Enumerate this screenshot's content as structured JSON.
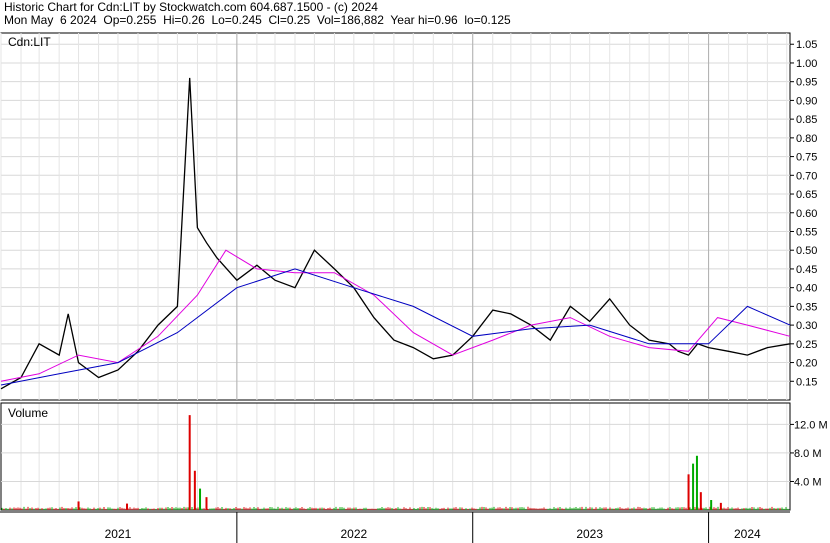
{
  "header": {
    "line1": "Historic Chart for Cdn:LIT by Stockwatch.com 604.687.1500 - (c) 2024",
    "line2": "Mon May  6 2024  Op=0.255  Hi=0.26  Lo=0.245  Cl=0.25  Vol=186,882  Year hi=0.96  lo=0.125"
  },
  "chart_data": [
    {
      "type": "line",
      "symbol_label": "Cdn:LIT",
      "ylim": [
        0.1,
        1.08
      ],
      "y_ticks": [
        0.15,
        0.2,
        0.25,
        0.3,
        0.35,
        0.4,
        0.45,
        0.5,
        0.55,
        0.6,
        0.65,
        0.7,
        0.75,
        0.8,
        0.85,
        0.9,
        0.95,
        1.0,
        1.05
      ],
      "y_tick_labels": [
        "0.15",
        "0.20",
        "0.25",
        "0.30",
        "0.35",
        "0.40",
        "0.45",
        "0.50",
        "0.55",
        "0.60",
        "0.65",
        "0.70",
        "0.75",
        "0.80",
        "0.85",
        "0.90",
        "0.95",
        "1.00",
        "1.05"
      ],
      "x_range": [
        "2021-01-01",
        "2024-05-06"
      ],
      "x_labels": [
        {
          "date": "2021-07-01",
          "label": "2021"
        },
        {
          "date": "2022-07-01",
          "label": "2022"
        },
        {
          "date": "2023-07-01",
          "label": "2023"
        },
        {
          "date": "2024-03-01",
          "label": "2024"
        }
      ],
      "year_dividers": [
        "2022-01-01",
        "2023-01-01",
        "2024-01-01"
      ],
      "series": [
        {
          "color": "#000000",
          "x": [
            "2021-01-01",
            "2021-02-01",
            "2021-03-01",
            "2021-04-01",
            "2021-04-15",
            "2021-05-01",
            "2021-06-01",
            "2021-07-01",
            "2021-08-01",
            "2021-09-01",
            "2021-10-01",
            "2021-10-20",
            "2021-11-01",
            "2021-11-15",
            "2021-12-01",
            "2022-01-01",
            "2022-02-01",
            "2022-03-01",
            "2022-04-01",
            "2022-05-01",
            "2022-06-01",
            "2022-07-01",
            "2022-08-01",
            "2022-09-01",
            "2022-10-01",
            "2022-11-01",
            "2022-12-01",
            "2023-01-01",
            "2023-02-01",
            "2023-03-01",
            "2023-04-01",
            "2023-05-01",
            "2023-06-01",
            "2023-07-01",
            "2023-08-01",
            "2023-09-01",
            "2023-10-01",
            "2023-11-01",
            "2023-11-15",
            "2023-12-01",
            "2023-12-15",
            "2024-01-01",
            "2024-02-01",
            "2024-03-01",
            "2024-04-01",
            "2024-05-06"
          ],
          "y": [
            0.13,
            0.16,
            0.25,
            0.22,
            0.33,
            0.2,
            0.16,
            0.18,
            0.23,
            0.3,
            0.35,
            0.96,
            0.56,
            0.52,
            0.48,
            0.42,
            0.46,
            0.42,
            0.4,
            0.5,
            0.45,
            0.4,
            0.32,
            0.26,
            0.24,
            0.21,
            0.22,
            0.27,
            0.34,
            0.33,
            0.3,
            0.26,
            0.35,
            0.31,
            0.37,
            0.3,
            0.26,
            0.25,
            0.23,
            0.22,
            0.25,
            0.24,
            0.23,
            0.22,
            0.24,
            0.25
          ]
        },
        {
          "color": "#e000e0",
          "x": [
            "2021-01-01",
            "2021-03-01",
            "2021-05-01",
            "2021-07-01",
            "2021-09-01",
            "2021-11-01",
            "2021-12-15",
            "2022-02-01",
            "2022-04-01",
            "2022-06-01",
            "2022-08-01",
            "2022-10-01",
            "2022-12-01",
            "2023-02-01",
            "2023-04-01",
            "2023-06-01",
            "2023-08-01",
            "2023-10-01",
            "2023-12-01",
            "2024-01-15",
            "2024-03-01",
            "2024-05-06"
          ],
          "y": [
            0.15,
            0.17,
            0.22,
            0.2,
            0.27,
            0.38,
            0.5,
            0.45,
            0.44,
            0.44,
            0.38,
            0.28,
            0.22,
            0.26,
            0.3,
            0.32,
            0.27,
            0.24,
            0.23,
            0.32,
            0.3,
            0.27
          ]
        },
        {
          "color": "#0000c0",
          "x": [
            "2021-01-01",
            "2021-04-01",
            "2021-07-01",
            "2021-10-01",
            "2022-01-01",
            "2022-04-01",
            "2022-07-01",
            "2022-10-01",
            "2023-01-01",
            "2023-04-01",
            "2023-07-01",
            "2023-10-01",
            "2024-01-01",
            "2024-03-01",
            "2024-05-06"
          ],
          "y": [
            0.14,
            0.17,
            0.2,
            0.28,
            0.4,
            0.45,
            0.4,
            0.35,
            0.27,
            0.29,
            0.3,
            0.25,
            0.25,
            0.35,
            0.3
          ]
        }
      ]
    },
    {
      "type": "bar",
      "title": "Volume",
      "ylim": [
        0,
        15
      ],
      "y_ticks": [
        4,
        8,
        12
      ],
      "y_tick_labels": [
        "4.0 M",
        "8.0 M",
        "12.0 M"
      ],
      "x_range": [
        "2021-01-01",
        "2024-05-06"
      ],
      "colors": {
        "up": "#00aa00",
        "down": "#dd0000"
      },
      "spikes": [
        {
          "date": "2021-05-01",
          "value": 1.2,
          "color": "down"
        },
        {
          "date": "2021-07-15",
          "value": 0.9,
          "color": "down"
        },
        {
          "date": "2021-10-20",
          "value": 13.3,
          "color": "down"
        },
        {
          "date": "2021-10-28",
          "value": 5.5,
          "color": "down"
        },
        {
          "date": "2021-11-05",
          "value": 3.0,
          "color": "up"
        },
        {
          "date": "2021-11-15",
          "value": 1.8,
          "color": "down"
        },
        {
          "date": "2023-12-01",
          "value": 5.0,
          "color": "down"
        },
        {
          "date": "2023-12-08",
          "value": 6.5,
          "color": "up"
        },
        {
          "date": "2023-12-14",
          "value": 7.6,
          "color": "up"
        },
        {
          "date": "2023-12-20",
          "value": 2.5,
          "color": "down"
        },
        {
          "date": "2024-01-05",
          "value": 1.4,
          "color": "up"
        },
        {
          "date": "2024-01-20",
          "value": 1.0,
          "color": "down"
        }
      ],
      "baseline_range": [
        0.15,
        0.45
      ]
    }
  ]
}
